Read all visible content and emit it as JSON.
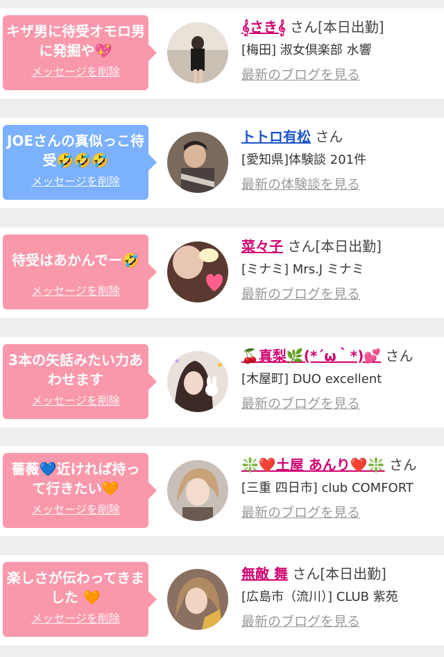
{
  "delete_label": "メッセージを削除",
  "cards": [
    {
      "bubble_text": "キザ男に待受オモロ男に発掘や💖",
      "name": "𝄞さき𝄞",
      "suffix": "さん[本日出勤]",
      "shop": "[梅田] 淑女倶楽部 水響",
      "blog_link": "最新のブログを見る"
    },
    {
      "bubble_text": "JOEさんの真似っこ待受🤣🤣🤣",
      "name": "トトロ有松",
      "suffix": "さん",
      "shop": "[愛知県]体験談 201件",
      "blog_link": "最新の体験談を見る"
    },
    {
      "bubble_text": "待受はあかんでー🤣",
      "name": "菜々子",
      "suffix": "さん[本日出勤]",
      "shop": "[ミナミ] Mrs.J ミナミ",
      "blog_link": "最新のブログを見る"
    },
    {
      "bubble_text": "3本の矢話みたい力あわせます",
      "name": "🍒真梨🌿(*´ω｀*)💕",
      "suffix": "さん",
      "shop": "[木屋町] DUO excellent",
      "blog_link": "最新のブログを見る"
    },
    {
      "bubble_text": "薔薇💙近ければ持って行きたい🧡",
      "name": "❇️❤️土屋 あんり❤️❇️",
      "suffix": "さん",
      "shop": "[三重 四日市] club COMFORT",
      "blog_link": "最新のブログを見る"
    },
    {
      "bubble_text": "楽しさが伝わってきました 🧡",
      "name": "無敵 舞",
      "suffix": "さん[本日出勤]",
      "shop": "[広島市（流川）] CLUB 紫苑",
      "blog_link": "最新のブログを見る"
    }
  ],
  "colors": {
    "bubble_pink": "#fa98ab",
    "bubble_blue": "#7bb1ff",
    "name_pink": "#d0006f",
    "name_blue": "#1c55c9",
    "blog_link_gray": "#9a9a9a",
    "page_bg": "#eeeeee"
  }
}
